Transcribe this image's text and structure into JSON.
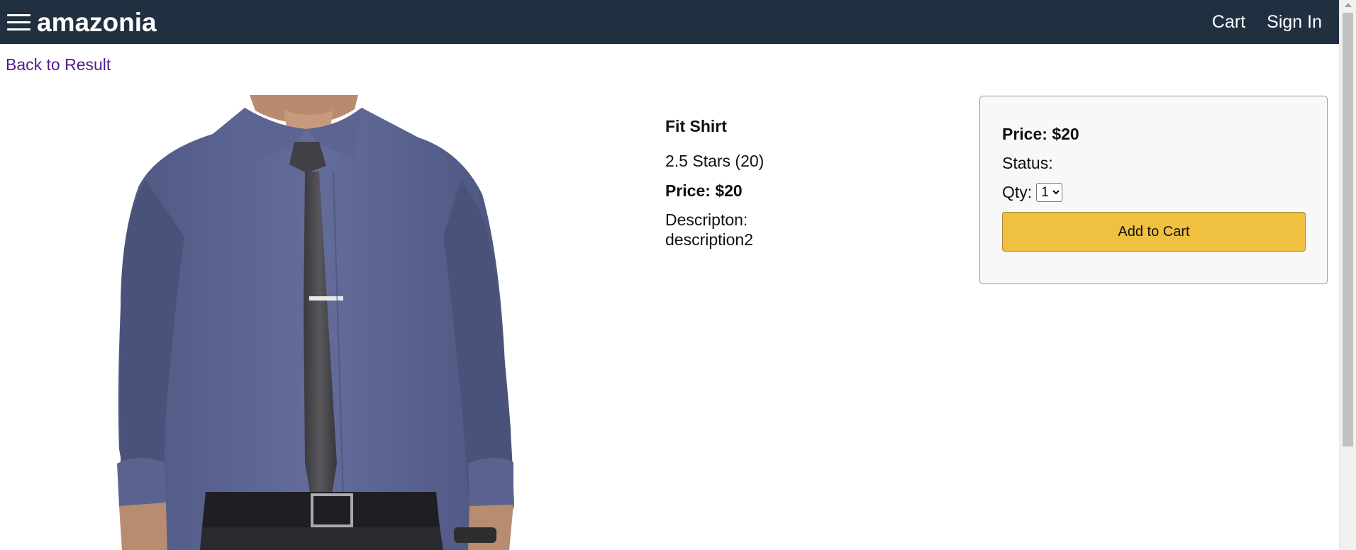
{
  "header": {
    "brand": "amazonia",
    "links": {
      "cart": "Cart",
      "sign_in": "Sign In"
    },
    "background": "#203040"
  },
  "nav": {
    "back_label": "Back to Result"
  },
  "product": {
    "name": "Fit Shirt",
    "rating_text": "2.5 Stars (20)",
    "price_text": "Price: $20",
    "description_label": "Descripton:",
    "description_value": "description2"
  },
  "action_card": {
    "price_text": "Price: $20",
    "status_label": "Status:",
    "qty_label": "Qty:",
    "qty_options": [
      "1"
    ],
    "qty_selected": "1",
    "add_to_cart_label": "Add to Cart",
    "button_color": "#f0c040"
  }
}
